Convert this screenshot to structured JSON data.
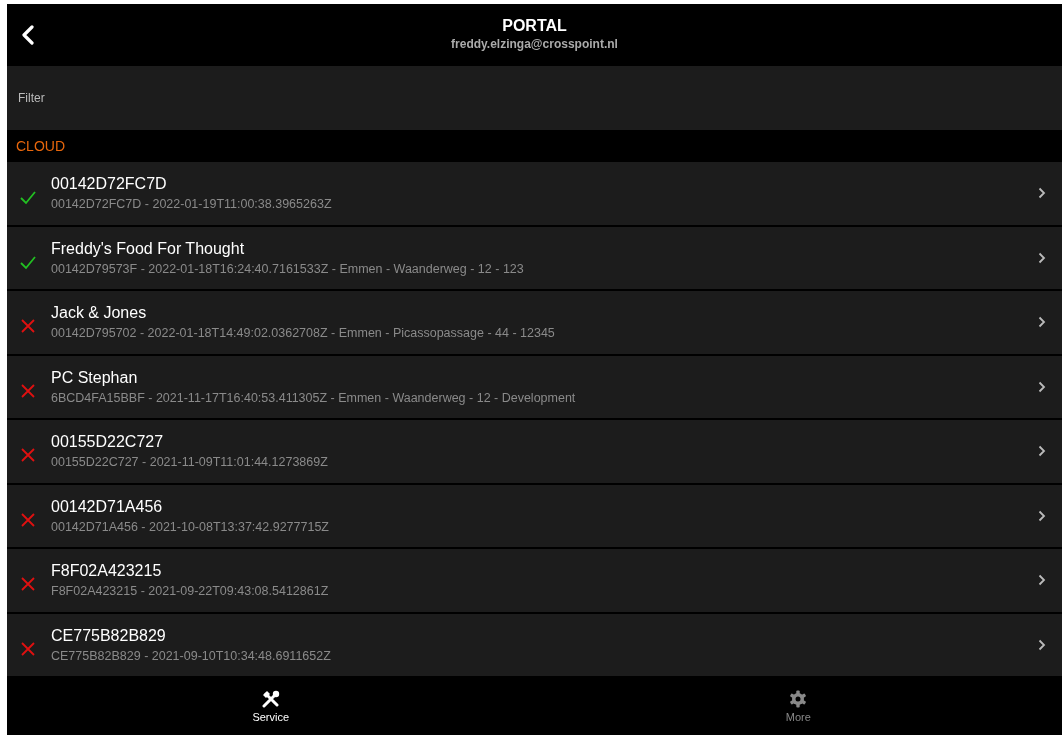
{
  "header": {
    "title": "PORTAL",
    "subtitle": "freddy.elzinga@crosspoint.nl"
  },
  "filter": {
    "placeholder": "Filter"
  },
  "section": {
    "title": "CLOUD"
  },
  "devices": [
    {
      "name": "00142D72FC7D",
      "detail": "00142D72FC7D - 2022-01-19T11:00:38.3965263Z",
      "online": true
    },
    {
      "name": "Freddy's Food For Thought",
      "detail": "00142D79573F - 2022-01-18T16:24:40.7161533Z - Emmen - Waanderweg - 12 - 123",
      "online": true
    },
    {
      "name": "Jack & Jones",
      "detail": "00142D795702 - 2022-01-18T14:49:02.0362708Z - Emmen - Picassopassage - 44 - 12345",
      "online": false
    },
    {
      "name": "PC Stephan",
      "detail": "6BCD4FA15BBF - 2021-11-17T16:40:53.411305Z - Emmen - Waanderweg - 12 - Development",
      "online": false
    },
    {
      "name": "00155D22C727",
      "detail": "00155D22C727 - 2021-11-09T11:01:44.1273869Z",
      "online": false
    },
    {
      "name": "00142D71A456",
      "detail": "00142D71A456 - 2021-10-08T13:37:42.9277715Z",
      "online": false
    },
    {
      "name": "F8F02A423215",
      "detail": "F8F02A423215 - 2021-09-22T09:43:08.5412861Z",
      "online": false
    },
    {
      "name": "CE775B82B829",
      "detail": "CE775B82B829 - 2021-09-10T10:34:48.6911652Z",
      "online": false
    }
  ],
  "tabs": [
    {
      "label": "Service",
      "kind": "tools",
      "selected": true
    },
    {
      "label": "More",
      "kind": "gear",
      "selected": false
    }
  ]
}
